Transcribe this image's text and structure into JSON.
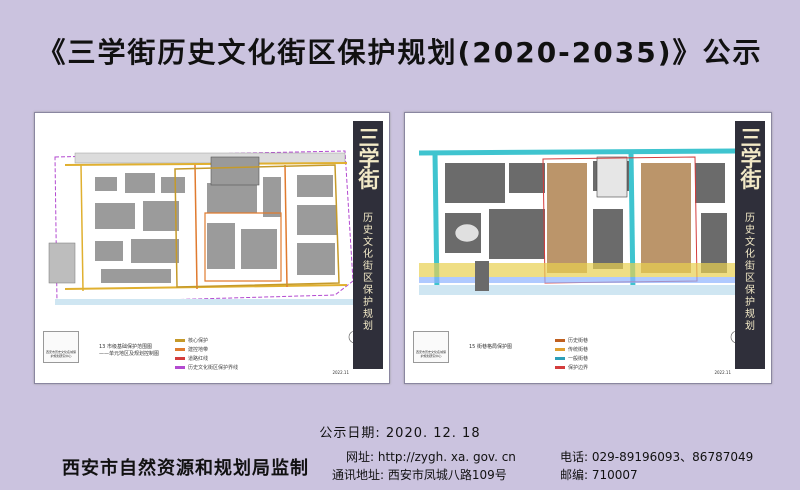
{
  "title": "《三学街历史文化街区保护规划(2020-2035)》公示",
  "panels": {
    "left": {
      "side_title_big": "三学街",
      "side_title_small": "历史文化街区保护规划",
      "caption": "13 市级基础保护范围图",
      "caption_sub": "——单元地区及规划控制图",
      "logo_label": "西安市历史文化名城保护规划研究中心",
      "date": "2022.11",
      "legend_items": [
        {
          "label": "核心保护",
          "color": "#c59a2a"
        },
        {
          "label": "建控地带",
          "color": "#e07b2f"
        },
        {
          "label": "道路红线",
          "color": "#d43c3c"
        },
        {
          "label": "历史文化街区保护界线",
          "color": "#b34ad0"
        }
      ]
    },
    "right": {
      "side_title_big": "三学街",
      "side_title_small": "历史文化街区保护规划",
      "caption": "15 街巷格局保护图",
      "logo_label": "西安市历史文化名城保护规划研究中心",
      "date": "2022.11",
      "legend_items": [
        {
          "label": "历史街巷",
          "color": "#c06020"
        },
        {
          "label": "传统街巷",
          "color": "#e0a030"
        },
        {
          "label": "一般街巷",
          "color": "#2c9fb8"
        },
        {
          "label": "保护边界",
          "color": "#d43c3c"
        }
      ]
    }
  },
  "publication_date": "公示日期: 2020. 12. 18",
  "footer": {
    "organization": "西安市自然资源和规划局监制",
    "website": "网址: http://zygh. xa. gov. cn",
    "address": "通讯地址: 西安市凤城八路109号",
    "phone": "电话: 029-89196093、86787049",
    "zip": "邮编: 710007"
  }
}
